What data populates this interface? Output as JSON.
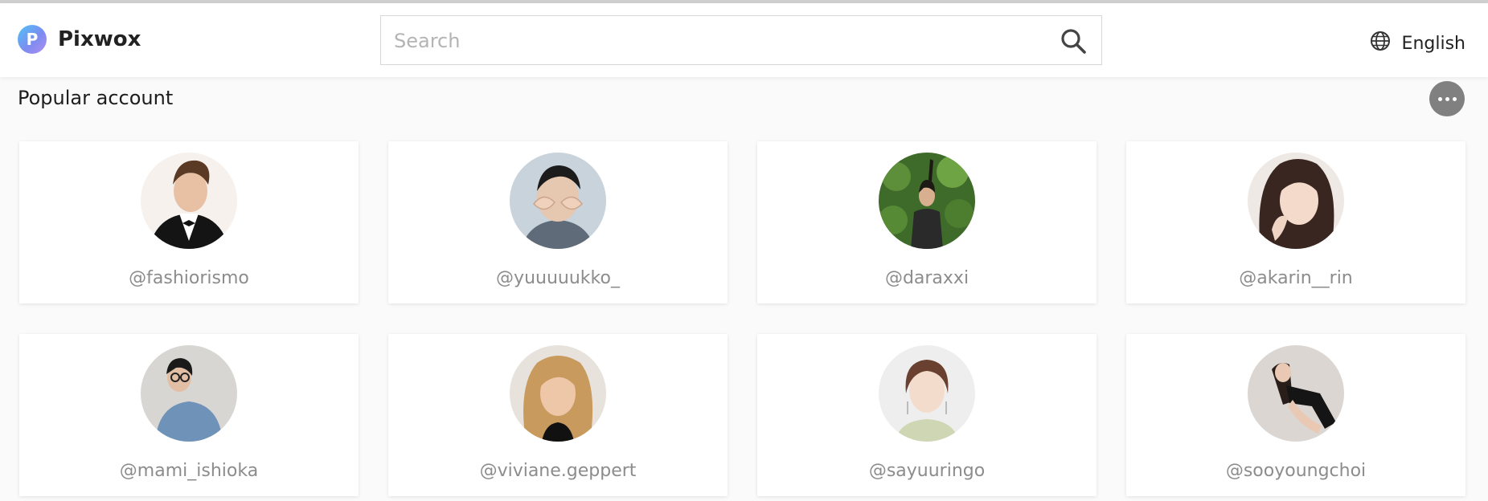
{
  "brand": {
    "name": "Pixwox",
    "logo_letter": "P"
  },
  "search": {
    "placeholder": "Search",
    "value": ""
  },
  "language": {
    "label": "English"
  },
  "section": {
    "title": "Popular account"
  },
  "accounts": [
    {
      "handle": "@fashiorismo"
    },
    {
      "handle": "@yuuuuukko_"
    },
    {
      "handle": "@daraxxi"
    },
    {
      "handle": "@akarin__rin"
    },
    {
      "handle": "@mami_ishioka"
    },
    {
      "handle": "@viviane.geppert"
    },
    {
      "handle": "@sayuuringo"
    },
    {
      "handle": "@sooyoungchoi"
    }
  ],
  "colors": {
    "accent_gradient_start": "#4fc3f7",
    "accent_gradient_end": "#b28ef0",
    "more_button": "#808080",
    "handle_text": "#8c8c8c"
  }
}
